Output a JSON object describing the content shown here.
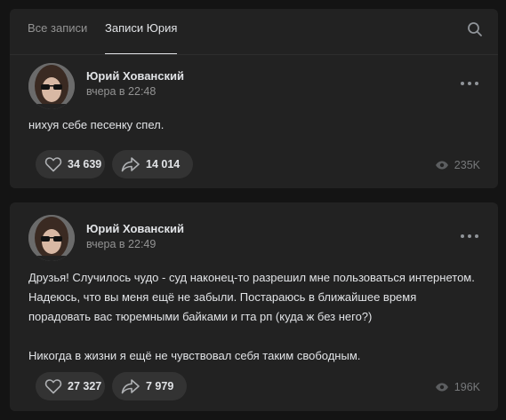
{
  "tabs": [
    {
      "label": "Все записи",
      "active": false
    },
    {
      "label": "Записи Юрия",
      "active": true
    }
  ],
  "posts": [
    {
      "author": "Юрий Хованский",
      "date": "вчера в 22:48",
      "text": [
        "нихуя себе песенку спел."
      ],
      "likes": "34 639",
      "shares": "14 014",
      "views": "235K"
    },
    {
      "author": "Юрий Хованский",
      "date": "вчера в 22:49",
      "text": [
        "Друзья! Случилось чудо - суд наконец-то разрешил мне пользоваться интернетом.",
        "Надеюсь, что вы меня ещё не забыли. Постараюсь в ближайшее время",
        "порадовать вас тюремными байками и гта рп (куда ж без него?)",
        "",
        "Никогда в жизни я ещё не чувствовал себя таким свободным."
      ],
      "likes": "27 327",
      "shares": "7 979",
      "views": "196K"
    }
  ],
  "colors": {
    "background": "#141414",
    "card": "#222222",
    "pill": "#333333",
    "text": "#e1e3e6",
    "muted": "#939393"
  },
  "icons": {
    "search": "search-icon",
    "more": "more-horizontal-icon",
    "like": "heart-icon",
    "share": "share-arrow-icon",
    "views": "eye-icon"
  }
}
